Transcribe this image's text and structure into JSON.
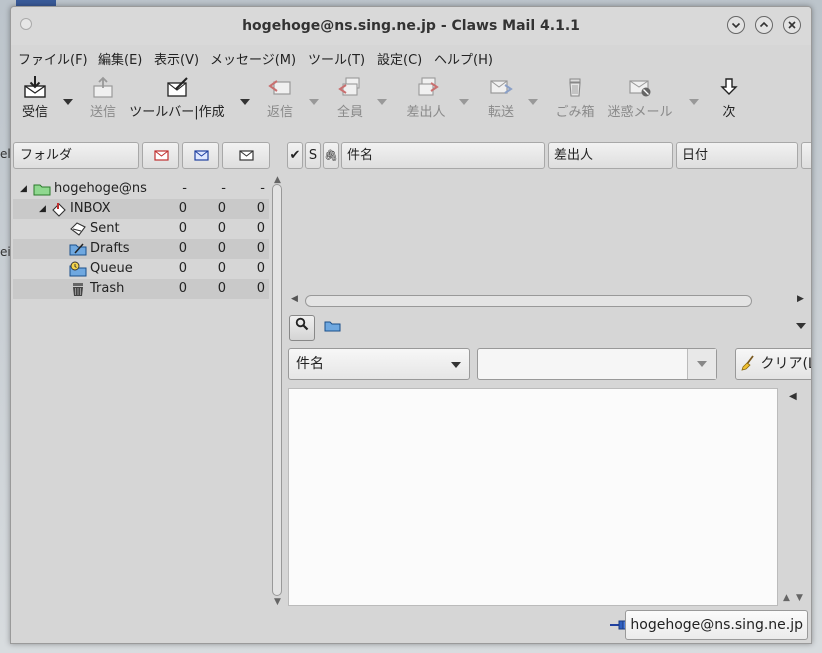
{
  "window": {
    "title": "hogehoge@ns.sing.ne.jp - Claws Mail 4.1.1"
  },
  "menu": [
    "ファイル(F)",
    "編集(E)",
    "表示(V)",
    "メッセージ(M)",
    "ツール(T)",
    "設定(C)",
    "ヘルプ(H)"
  ],
  "toolbar": {
    "receive": "受信",
    "send": "送信",
    "compose": "ツールバー|作成",
    "reply": "返信",
    "reply_all": "全員",
    "reply_sender": "差出人",
    "forward": "転送",
    "trash": "ごみ箱",
    "spam": "迷惑メール",
    "next": "次"
  },
  "folder_pane": {
    "header": "フォルダ",
    "account": {
      "name": "hogehoge@ns",
      "new": "-",
      "unread": "-",
      "total": "-"
    },
    "folders": [
      {
        "name": "INBOX",
        "new": "0",
        "unread": "0",
        "total": "0"
      },
      {
        "name": "Sent",
        "new": "0",
        "unread": "0",
        "total": "0"
      },
      {
        "name": "Drafts",
        "new": "0",
        "unread": "0",
        "total": "0"
      },
      {
        "name": "Queue",
        "new": "0",
        "unread": "0",
        "total": "0"
      },
      {
        "name": "Trash",
        "new": "0",
        "unread": "0",
        "total": "0"
      }
    ]
  },
  "message_list": {
    "columns": {
      "mark": "✔",
      "status": "S",
      "attach": "🖇",
      "subject": "件名",
      "from": "差出人",
      "date": "日付"
    }
  },
  "search": {
    "field": "件名",
    "query": "",
    "clear": "クリア(L)"
  },
  "status": {
    "account": "hogehoge@ns.sing.ne.jp"
  },
  "desktop": {
    "fragments": [
      "el",
      "ei"
    ]
  }
}
